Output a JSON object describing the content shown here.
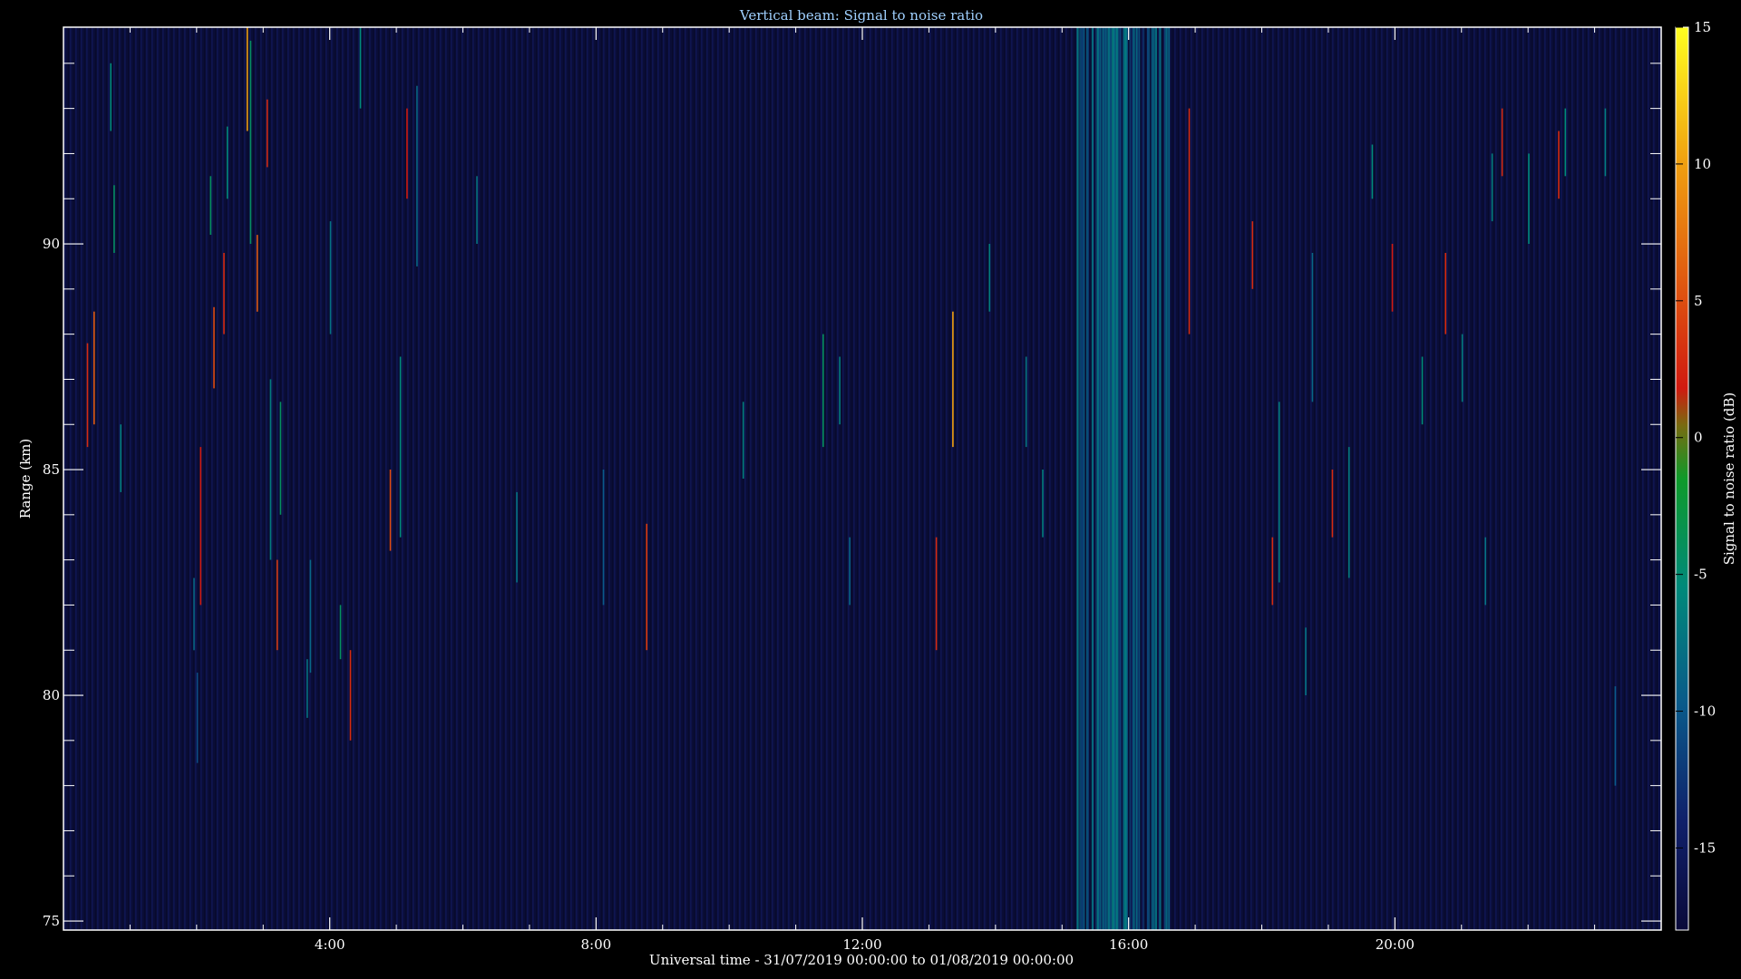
{
  "chart_data": {
    "type": "heatmap",
    "title": "Vertical beam: Signal to noise ratio",
    "xlabel": "Universal time - 31/07/2019 00:00:00 to 01/08/2019 00:00:00",
    "ylabel": "Range (km)",
    "colorbar_label": "Signal to noise ratio (dB)",
    "xlim_hours": [
      0,
      24
    ],
    "ylim_km": [
      74.8,
      94.8
    ],
    "clim_db": [
      -18,
      15
    ],
    "x_ticks": [
      {
        "hours": 4,
        "label": "4:00"
      },
      {
        "hours": 8,
        "label": "8:00"
      },
      {
        "hours": 12,
        "label": "12:00"
      },
      {
        "hours": 16,
        "label": "16:00"
      },
      {
        "hours": 20,
        "label": "20:00"
      }
    ],
    "y_ticks": [
      {
        "km": 75,
        "label": "75"
      },
      {
        "km": 80,
        "label": "80"
      },
      {
        "km": 85,
        "label": "85"
      },
      {
        "km": 90,
        "label": "90"
      }
    ],
    "colorbar_ticks": [
      {
        "db": 15,
        "label": "15"
      },
      {
        "db": 10,
        "label": "10"
      },
      {
        "db": 5,
        "label": "5"
      },
      {
        "db": 0,
        "label": "0"
      },
      {
        "db": -5,
        "label": "-5"
      },
      {
        "db": -10,
        "label": "-10"
      },
      {
        "db": -15,
        "label": "-15"
      }
    ],
    "background_db": -17,
    "streaks": [
      {
        "t": 0.35,
        "r0": 85.5,
        "r1": 87.8,
        "db": 2
      },
      {
        "t": 0.45,
        "r0": 86.0,
        "r1": 88.5,
        "db": 5
      },
      {
        "t": 0.7,
        "r0": 92.5,
        "r1": 94.0,
        "db": -6
      },
      {
        "t": 0.75,
        "r0": 89.8,
        "r1": 91.3,
        "db": -5
      },
      {
        "t": 0.85,
        "r0": 84.5,
        "r1": 86.0,
        "db": -7
      },
      {
        "t": 1.95,
        "r0": 81.0,
        "r1": 82.6,
        "db": -9
      },
      {
        "t": 2.0,
        "r0": 78.5,
        "r1": 80.5,
        "db": -11
      },
      {
        "t": 2.05,
        "r0": 82.0,
        "r1": 85.5,
        "db": 1
      },
      {
        "t": 2.2,
        "r0": 90.2,
        "r1": 91.5,
        "db": -5
      },
      {
        "t": 2.25,
        "r0": 86.8,
        "r1": 88.6,
        "db": 4
      },
      {
        "t": 2.4,
        "r0": 88.0,
        "r1": 89.8,
        "db": 2
      },
      {
        "t": 2.45,
        "r0": 91.0,
        "r1": 92.6,
        "db": -6
      },
      {
        "t": 2.75,
        "r0": 92.5,
        "r1": 94.8,
        "db": 10
      },
      {
        "t": 2.8,
        "r0": 90.0,
        "r1": 94.5,
        "db": -5
      },
      {
        "t": 2.9,
        "r0": 88.5,
        "r1": 90.2,
        "db": 5
      },
      {
        "t": 3.05,
        "r0": 91.7,
        "r1": 93.2,
        "db": 2
      },
      {
        "t": 3.1,
        "r0": 83.0,
        "r1": 87.0,
        "db": -7
      },
      {
        "t": 3.2,
        "r0": 81.0,
        "r1": 83.0,
        "db": 3
      },
      {
        "t": 3.25,
        "r0": 84.0,
        "r1": 86.5,
        "db": -5
      },
      {
        "t": 3.65,
        "r0": 79.5,
        "r1": 80.8,
        "db": -8
      },
      {
        "t": 3.7,
        "r0": 80.5,
        "r1": 83.0,
        "db": -9
      },
      {
        "t": 4.0,
        "r0": 88.0,
        "r1": 90.5,
        "db": -8
      },
      {
        "t": 4.15,
        "r0": 80.8,
        "r1": 82.0,
        "db": -5
      },
      {
        "t": 4.3,
        "r0": 79.0,
        "r1": 81.0,
        "db": 2
      },
      {
        "t": 4.45,
        "r0": 93.0,
        "r1": 94.8,
        "db": -6
      },
      {
        "t": 4.9,
        "r0": 83.2,
        "r1": 85.0,
        "db": 4
      },
      {
        "t": 5.05,
        "r0": 83.5,
        "r1": 87.5,
        "db": -6
      },
      {
        "t": 5.15,
        "r0": 91.0,
        "r1": 93.0,
        "db": 1
      },
      {
        "t": 5.3,
        "r0": 89.5,
        "r1": 93.5,
        "db": -9
      },
      {
        "t": 6.2,
        "r0": 90.0,
        "r1": 91.5,
        "db": -8
      },
      {
        "t": 6.8,
        "r0": 82.5,
        "r1": 84.5,
        "db": -8
      },
      {
        "t": 8.1,
        "r0": 82.0,
        "r1": 85.0,
        "db": -10
      },
      {
        "t": 8.75,
        "r0": 81.0,
        "r1": 83.8,
        "db": 3
      },
      {
        "t": 10.2,
        "r0": 84.8,
        "r1": 86.5,
        "db": -7
      },
      {
        "t": 11.4,
        "r0": 85.5,
        "r1": 88.0,
        "db": -5
      },
      {
        "t": 11.65,
        "r0": 86.0,
        "r1": 87.5,
        "db": -7
      },
      {
        "t": 11.8,
        "r0": 82.0,
        "r1": 83.5,
        "db": -9
      },
      {
        "t": 13.1,
        "r0": 81.0,
        "r1": 83.5,
        "db": 2
      },
      {
        "t": 13.35,
        "r0": 85.5,
        "r1": 88.5,
        "db": 10
      },
      {
        "t": 13.9,
        "r0": 88.5,
        "r1": 90.0,
        "db": -7
      },
      {
        "t": 14.45,
        "r0": 85.5,
        "r1": 87.5,
        "db": -8
      },
      {
        "t": 14.7,
        "r0": 83.5,
        "r1": 85.0,
        "db": -7
      },
      {
        "t": 16.9,
        "r0": 88.0,
        "r1": 93.0,
        "db": 2
      },
      {
        "t": 17.85,
        "r0": 89.0,
        "r1": 90.5,
        "db": 2
      },
      {
        "t": 18.15,
        "r0": 82.0,
        "r1": 83.5,
        "db": 2
      },
      {
        "t": 18.25,
        "r0": 82.5,
        "r1": 86.5,
        "db": -7
      },
      {
        "t": 18.65,
        "r0": 80.0,
        "r1": 81.5,
        "db": -8
      },
      {
        "t": 18.75,
        "r0": 86.5,
        "r1": 89.8,
        "db": -9
      },
      {
        "t": 19.05,
        "r0": 83.5,
        "r1": 85.0,
        "db": 2
      },
      {
        "t": 19.3,
        "r0": 82.6,
        "r1": 85.5,
        "db": -7
      },
      {
        "t": 19.65,
        "r0": 91.0,
        "r1": 92.2,
        "db": -6
      },
      {
        "t": 19.95,
        "r0": 88.5,
        "r1": 90.0,
        "db": 1
      },
      {
        "t": 20.4,
        "r0": 86.0,
        "r1": 87.5,
        "db": -6
      },
      {
        "t": 20.75,
        "r0": 88.0,
        "r1": 89.8,
        "db": 2
      },
      {
        "t": 21.0,
        "r0": 86.5,
        "r1": 88.0,
        "db": -7
      },
      {
        "t": 21.35,
        "r0": 82.0,
        "r1": 83.5,
        "db": -8
      },
      {
        "t": 21.45,
        "r0": 90.5,
        "r1": 92.0,
        "db": -7
      },
      {
        "t": 21.6,
        "r0": 91.5,
        "r1": 93.0,
        "db": 2
      },
      {
        "t": 22.0,
        "r0": 90.0,
        "r1": 92.0,
        "db": -6
      },
      {
        "t": 22.45,
        "r0": 91.0,
        "r1": 92.5,
        "db": 2
      },
      {
        "t": 22.55,
        "r0": 91.5,
        "r1": 93.0,
        "db": -6
      },
      {
        "t": 23.15,
        "r0": 91.5,
        "r1": 93.0,
        "db": -7
      },
      {
        "t": 23.3,
        "r0": 78.0,
        "r1": 80.2,
        "db": -10
      }
    ],
    "band": {
      "t_start": 15.2,
      "t_end": 16.6,
      "db_range": [
        -13,
        -7
      ]
    }
  }
}
